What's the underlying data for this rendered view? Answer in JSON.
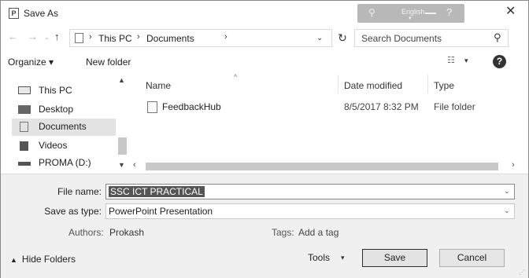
{
  "window": {
    "app_icon": "P",
    "title": "Save As",
    "language": "English",
    "controls": {
      "minimize_icon": "minimize-icon",
      "help_glyph": "?",
      "close_glyph": "✕"
    }
  },
  "navigation": {
    "back": "←",
    "forward": "→",
    "recent": "⌄",
    "up": "↑",
    "breadcrumbs": [
      "This PC",
      "Documents"
    ],
    "separator": "›",
    "refresh": "↻",
    "search_placeholder": "Search Documents"
  },
  "commands": {
    "organize": "Organize ▾",
    "new_folder": "New folder",
    "view": "☷",
    "help": "?"
  },
  "sidebar": {
    "items": [
      {
        "label": "This PC",
        "icon": "computer-icon"
      },
      {
        "label": "Desktop",
        "icon": "desktop-icon"
      },
      {
        "label": "Documents",
        "icon": "documents-icon",
        "selected": true
      },
      {
        "label": "Videos",
        "icon": "videos-icon"
      },
      {
        "label": "PROMA (D:)",
        "icon": "drive-icon"
      }
    ]
  },
  "files": {
    "columns": {
      "name": "Name",
      "date": "Date modified",
      "type": "Type"
    },
    "rows": [
      {
        "name": "FeedbackHub",
        "date": "8/5/2017 8:32 PM",
        "type": "File folder"
      }
    ]
  },
  "form": {
    "file_name_label": "File name:",
    "file_name_value": "SSC ICT PRACTICAL",
    "save_type_label": "Save as type:",
    "save_type_value": "PowerPoint Presentation",
    "authors_label": "Authors:",
    "authors_value": "Prokash",
    "tags_label": "Tags:",
    "tags_value": "Add a tag",
    "hide_folders": "Hide Folders",
    "tools": "Tools",
    "save": "Save",
    "cancel": "Cancel"
  },
  "colors": {
    "accent": "#555555",
    "selected_row": "#e3e3e3",
    "form_bg": "#f0f0f0"
  }
}
